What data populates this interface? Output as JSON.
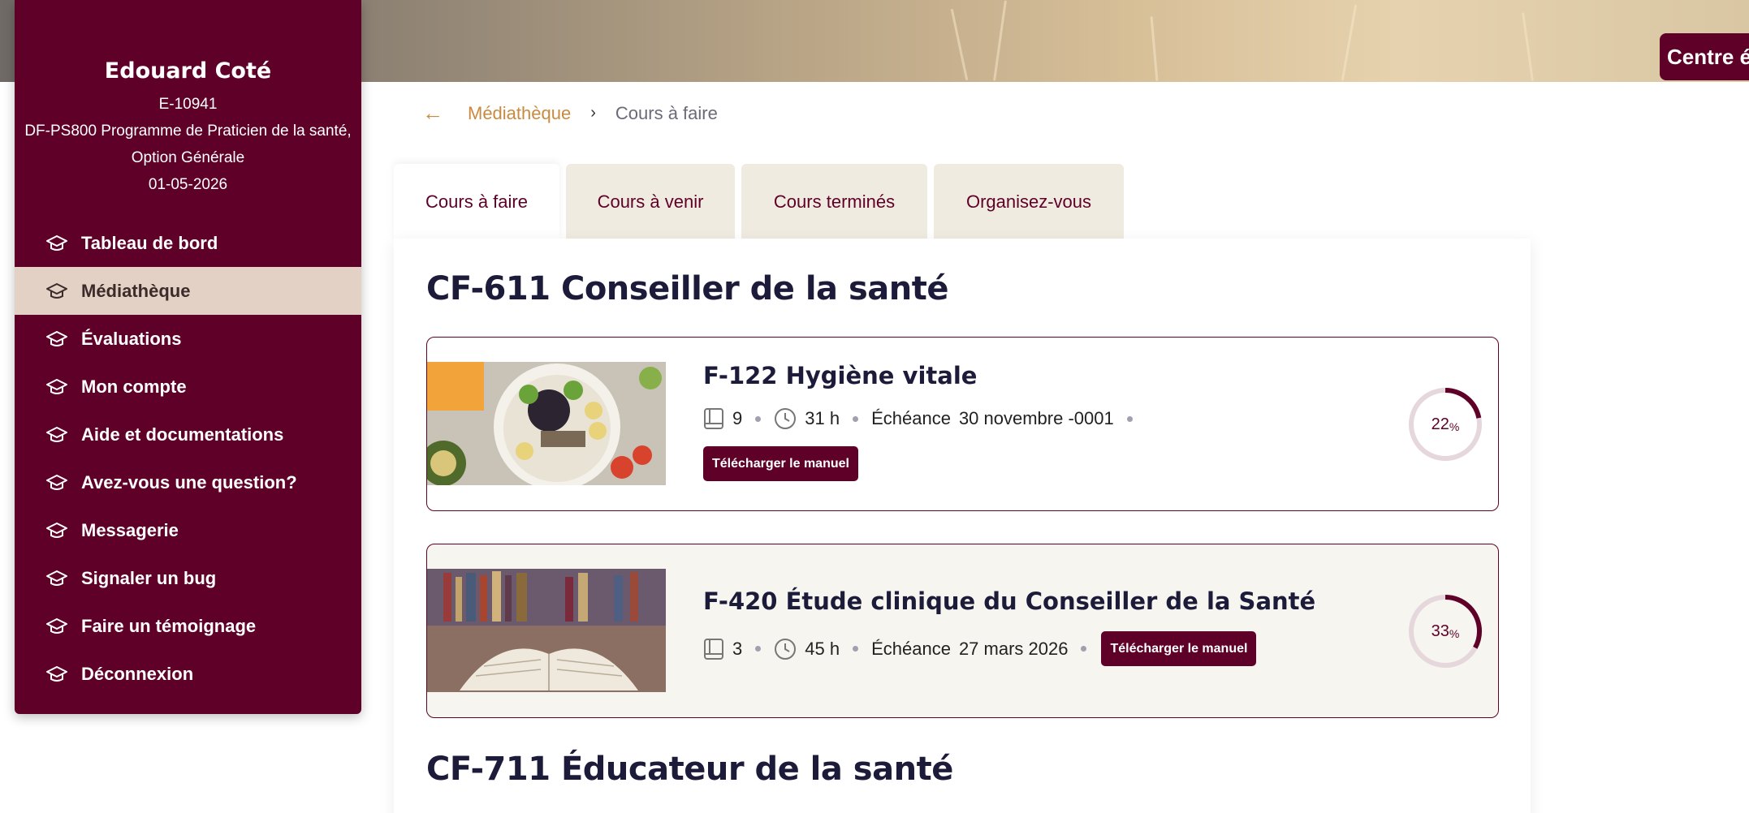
{
  "header": {
    "centre_button": "Centre ét"
  },
  "profile": {
    "name": "Edouard Coté",
    "student_id": "E-10941",
    "program_line1": "DF-PS800 Programme de Praticien de la santé,",
    "program_line2": "Option Générale",
    "date": "01-05-2026"
  },
  "sidebar": {
    "items": [
      {
        "label": "Tableau de bord"
      },
      {
        "label": "Médiathèque"
      },
      {
        "label": "Évaluations"
      },
      {
        "label": "Mon compte"
      },
      {
        "label": "Aide et documentations"
      },
      {
        "label": "Avez-vous une question?"
      },
      {
        "label": "Messagerie"
      },
      {
        "label": "Signaler un bug"
      },
      {
        "label": "Faire un témoignage"
      },
      {
        "label": "Déconnexion"
      }
    ],
    "active_index": 1
  },
  "breadcrumb": {
    "back": "←",
    "parent": "Médiathèque",
    "separator": "›",
    "current": "Cours à faire"
  },
  "tabs": [
    {
      "label": "Cours à faire"
    },
    {
      "label": "Cours à venir"
    },
    {
      "label": "Cours terminés"
    },
    {
      "label": "Organisez-vous"
    }
  ],
  "sections": [
    {
      "title": "CF-611 Conseiller de la santé",
      "courses": [
        {
          "title": "F-122 Hygiène vitale",
          "books": "9",
          "hours": "31 h",
          "deadline_label": "Échéance",
          "deadline": "30 novembre -0001",
          "download_label": "Télécharger le manuel",
          "progress": 22,
          "progress_text": "22",
          "percent_sign": "%"
        },
        {
          "title": "F-420 Étude clinique du Conseiller de la Santé",
          "books": "3",
          "hours": "45 h",
          "deadline_label": "Échéance",
          "deadline": "27 mars 2026",
          "download_label": "Télécharger le manuel",
          "progress": 33,
          "progress_text": "33",
          "percent_sign": "%"
        }
      ]
    },
    {
      "title": "CF-711 Éducateur de la santé"
    }
  ],
  "colors": {
    "brand": "#5e0028",
    "accent": "#c98a3f",
    "active_nav": "#e2d1c4",
    "tab_bg": "#f0ebe0"
  }
}
